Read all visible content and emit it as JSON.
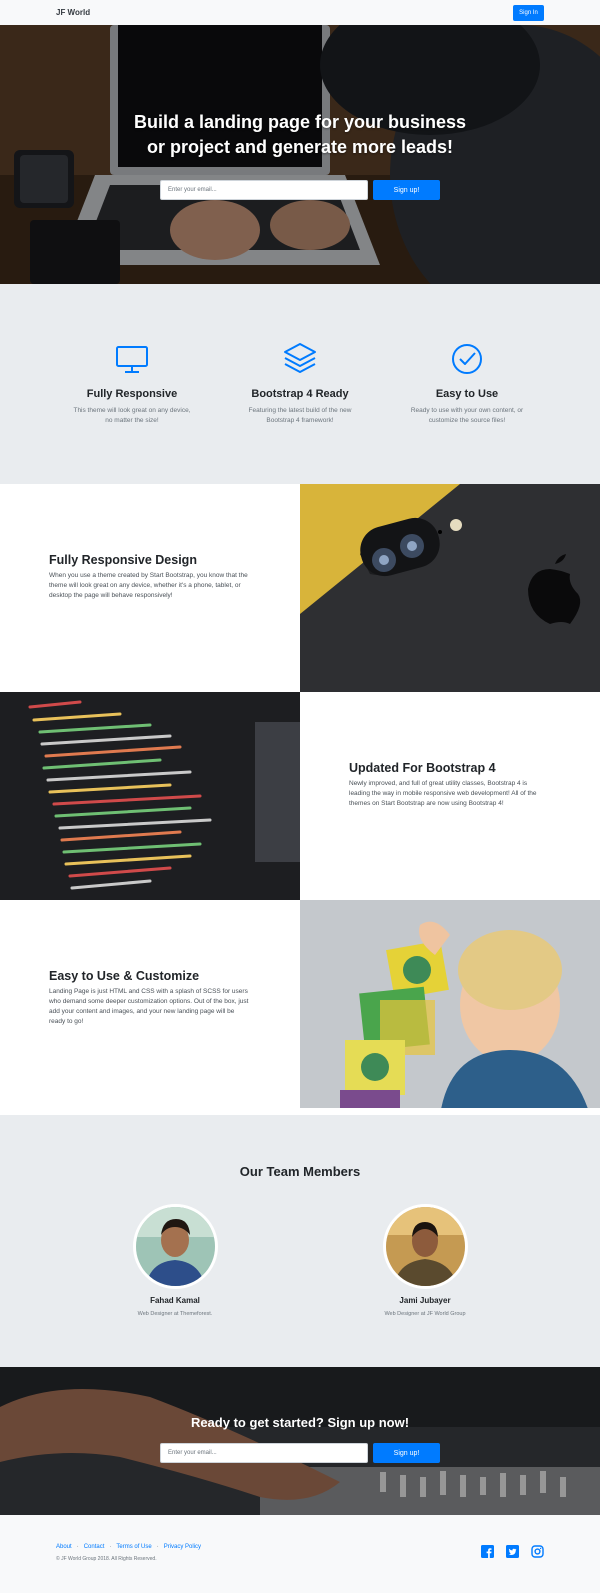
{
  "nav": {
    "brand": "JF World",
    "signin_label": "Sign In"
  },
  "hero": {
    "title_line1": "Build a landing page for your business",
    "title_line2": "or project and generate more leads!",
    "email_placeholder": "Enter your email...",
    "signup_label": "Sign up!"
  },
  "features": [
    {
      "icon": "monitor-icon",
      "title": "Fully Responsive",
      "desc": "This theme will look great on any device, no matter the size!"
    },
    {
      "icon": "layers-icon",
      "title": "Bootstrap 4 Ready",
      "desc": "Featuring the latest build of the new Bootstrap 4 framework!"
    },
    {
      "icon": "check-circle-icon",
      "title": "Easy to Use",
      "desc": "Ready to use with your own content, or customize the source files!"
    }
  ],
  "showcase": [
    {
      "title": "Fully Responsive Design",
      "desc": "When you use a theme created by Start Bootstrap, you know that the theme will look great on any device, whether it's a phone, tablet, or desktop the page will behave responsively!"
    },
    {
      "title": "Updated For Bootstrap 4",
      "desc": "Newly improved, and full of great utility classes, Bootstrap 4 is leading the way in mobile responsive web development! All of the themes on Start Bootstrap are now using Bootstrap 4!"
    },
    {
      "title": "Easy to Use & Customize",
      "desc": "Landing Page is just HTML and CSS with a splash of SCSS for users who demand some deeper customization options. Out of the box, just add your content and images, and your new landing page will be ready to go!"
    }
  ],
  "team": {
    "title": "Our Team Members",
    "members": [
      {
        "name": "Fahad Kamal",
        "role": "Web Designer at Themeforest."
      },
      {
        "name": "Jami Jubayer",
        "role": "Web Designer at JF World Group"
      }
    ]
  },
  "cta": {
    "title": "Ready to get started? Sign up now!",
    "email_placeholder": "Enter your email...",
    "signup_label": "Sign up!"
  },
  "footer": {
    "links": [
      "About",
      "Contact",
      "Terms of Use",
      "Privacy Policy"
    ],
    "separator": "·",
    "copyright": "© JF World Group 2018. All Rights Reserved.",
    "social": [
      "facebook-icon",
      "twitter-icon",
      "instagram-icon"
    ]
  },
  "colors": {
    "primary": "#007bff",
    "light_bg": "#e9ecef",
    "footer_bg": "#f8f9fa"
  }
}
